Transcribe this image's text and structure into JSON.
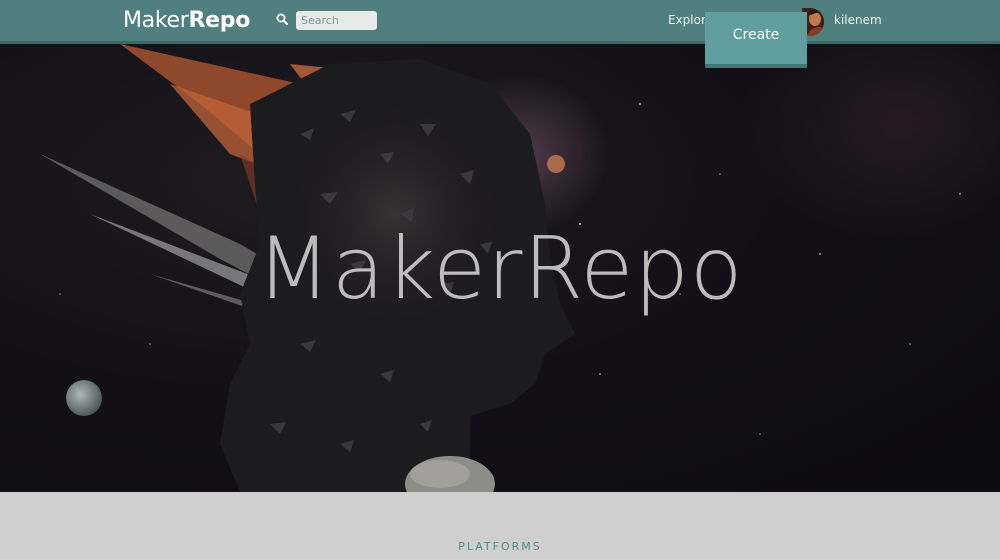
{
  "header": {
    "logo_light": "Maker",
    "logo_bold": "Repo",
    "search_placeholder": "Search",
    "explore_label": "Explore",
    "create_label": "Create",
    "username": "kilenem"
  },
  "hero": {
    "title": "MakerRepo"
  },
  "platforms": {
    "title": "PLATFORMS"
  },
  "colors": {
    "navbar": "#4f7f7e",
    "create_button": "#5f9e9c",
    "section_heading": "#4f8c8a"
  },
  "icons": {
    "search": "search-icon"
  }
}
